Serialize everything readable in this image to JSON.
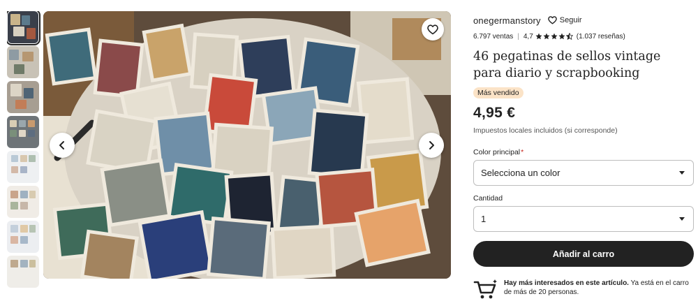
{
  "shop": {
    "name": "onegermanstory",
    "follow_label": "Seguir"
  },
  "stats": {
    "sales": "6.797 ventas",
    "rating": "4,7",
    "rating_stars": 4.5,
    "reviews": "(1.037 reseñas)"
  },
  "product": {
    "title": "46 pegatinas de sellos vintage para diario y scrapbooking",
    "badge": "Más vendido",
    "price": "4,95 €",
    "tax_note": "Impuestos locales incluidos (si corresponde)"
  },
  "options": {
    "color_label": "Color principal",
    "required_mark": "*",
    "color_value": "Selecciona un color",
    "quantity_label": "Cantidad",
    "quantity_value": "1"
  },
  "cart_button": "Añadir al carro",
  "interest": {
    "bold": "Hay más interesados en este artículo.",
    "rest": " Ya está en el carro de más de 20 personas."
  },
  "colors": {
    "badge_bg": "#fbe3c7",
    "button_bg": "#222222",
    "required": "#c7261e"
  }
}
